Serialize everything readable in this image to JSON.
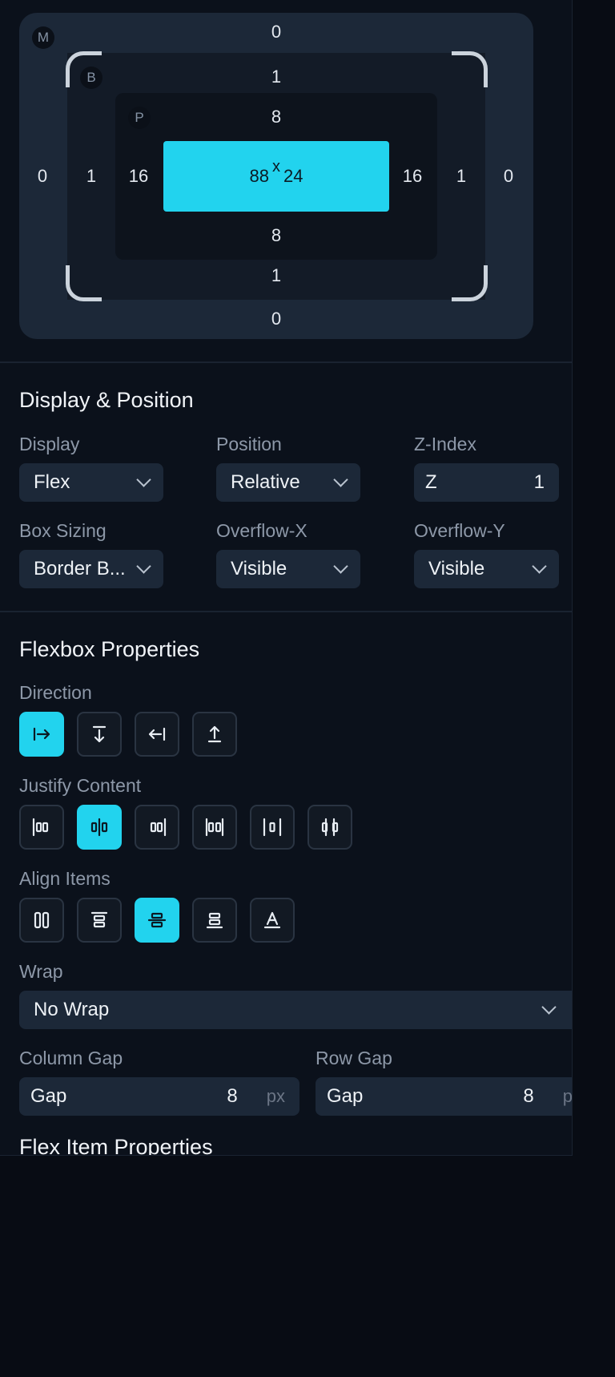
{
  "box_model": {
    "margin": {
      "tag": "M",
      "top": "0",
      "right": "0",
      "bottom": "0",
      "left": "0"
    },
    "border": {
      "tag": "B",
      "top": "1",
      "right": "1",
      "bottom": "1",
      "left": "1"
    },
    "padding": {
      "tag": "P",
      "top": "8",
      "right": "16",
      "bottom": "8",
      "left": "16"
    },
    "content": {
      "width": "88",
      "separator": "x",
      "height": "24"
    }
  },
  "display_position": {
    "title": "Display & Position",
    "display": {
      "label": "Display",
      "value": "Flex"
    },
    "position": {
      "label": "Position",
      "value": "Relative"
    },
    "z_index": {
      "label": "Z-Index",
      "prefix": "Z",
      "value": "1"
    },
    "box_sizing": {
      "label": "Box Sizing",
      "value": "Border B..."
    },
    "overflow_x": {
      "label": "Overflow-X",
      "value": "Visible"
    },
    "overflow_y": {
      "label": "Overflow-Y",
      "value": "Visible"
    }
  },
  "flexbox": {
    "title": "Flexbox Properties",
    "direction": {
      "label": "Direction",
      "options": [
        "direction-row-icon",
        "direction-column-icon",
        "direction-row-reverse-icon",
        "direction-column-reverse-icon"
      ],
      "active": 0
    },
    "justify": {
      "label": "Justify Content",
      "options": [
        "justify-start-icon",
        "justify-center-icon",
        "justify-end-icon",
        "justify-space-between-icon",
        "justify-space-around-icon",
        "justify-space-evenly-icon"
      ],
      "active": 1
    },
    "align": {
      "label": "Align Items",
      "options": [
        "align-stretch-icon",
        "align-start-icon",
        "align-center-icon",
        "align-end-icon",
        "align-baseline-icon"
      ],
      "active": 2
    },
    "wrap": {
      "label": "Wrap",
      "value": "No Wrap"
    },
    "column_gap": {
      "label": "Column Gap",
      "prefix": "Gap",
      "value": "8",
      "unit": "px"
    },
    "row_gap": {
      "label": "Row Gap",
      "prefix": "Gap",
      "value": "8",
      "unit": "px"
    }
  },
  "flex_item": {
    "title": "Flex Item Properties"
  },
  "colors": {
    "accent": "#22d3ee",
    "panel": "#0b111b",
    "field": "#1c2838"
  }
}
